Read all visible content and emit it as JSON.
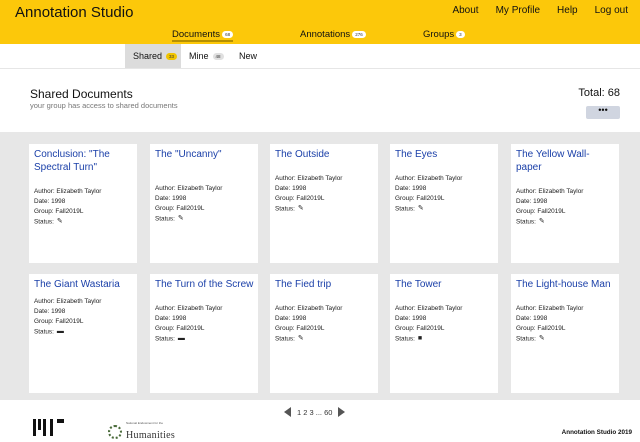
{
  "app": {
    "title": "Annotation Studio"
  },
  "top_links": [
    "About",
    "My Profile",
    "Help",
    "Log out"
  ],
  "main_tabs": [
    {
      "label": "Documents",
      "count": "68"
    },
    {
      "label": "Annotations",
      "count": "276"
    },
    {
      "label": "Groups",
      "count": "3"
    }
  ],
  "sub_tabs": [
    {
      "label": "Shared",
      "count": "33"
    },
    {
      "label": "Mine",
      "count": "48"
    },
    {
      "label": "New"
    }
  ],
  "header": {
    "title": "Shared Documents",
    "subtitle": "your group has access to shared documents",
    "total": "Total: 68",
    "more_label": "•••"
  },
  "labels": {
    "author": "Author:",
    "date": "Date:",
    "group": "Group:",
    "status": "Status:"
  },
  "cards": [
    {
      "title": "Conclusion: \"The Spectral Turn\"",
      "author": "Elizabeth Taylor",
      "date": "1998",
      "group": "Fall2019L",
      "status_icon": "pencil-icon"
    },
    {
      "title": "The \"Uncanny\"",
      "author": "Elizabeth Taylor",
      "date": "1998",
      "group": "Fall2019L",
      "status_icon": "pencil-icon"
    },
    {
      "title": "The Outside",
      "author": "Elizabeth Taylor",
      "date": "1998",
      "group": "Fall2019L",
      "status_icon": "pencil-icon"
    },
    {
      "title": "The Eyes",
      "author": "Elizabeth Taylor",
      "date": "1998",
      "group": "Fall2019L",
      "status_icon": "pencil-icon"
    },
    {
      "title": "The Yellow Wall-paper",
      "author": "Elizabeth Taylor",
      "date": "1998",
      "group": "Fall2019L",
      "status_icon": "pencil-icon"
    },
    {
      "title": "The Giant Wastaria",
      "author": "Elizabeth Taylor",
      "date": "1998",
      "group": "Fall2019L",
      "status_icon": "comment-icon"
    },
    {
      "title": "The Turn of the Screw",
      "author": "Elizabeth Taylor",
      "date": "1998",
      "group": "Fall2019L",
      "status_icon": "comment-icon"
    },
    {
      "title": "The Fied trip",
      "author": "Elizabeth Taylor",
      "date": "1998",
      "group": "Fall2019L",
      "status_icon": "pencil-icon"
    },
    {
      "title": "The Tower",
      "author": "Elizabeth Taylor",
      "date": "1998",
      "group": "Fall2019L",
      "status_icon": "folder-icon"
    },
    {
      "title": "The Light-house Man",
      "author": "Elizabeth Taylor",
      "date": "1998",
      "group": "Fall2019L",
      "status_icon": "pencil-icon"
    }
  ],
  "pager": {
    "pages": "1 2 3 ... 60"
  },
  "footer": {
    "neh_small": "National Endowment for the",
    "neh_text": "Humanities",
    "copyright": "Annotation Studio 2019"
  },
  "colors": {
    "brand_yellow": "#fcc80a",
    "link_blue": "#1a3fa8",
    "grid_bg": "#e7e7e7"
  }
}
